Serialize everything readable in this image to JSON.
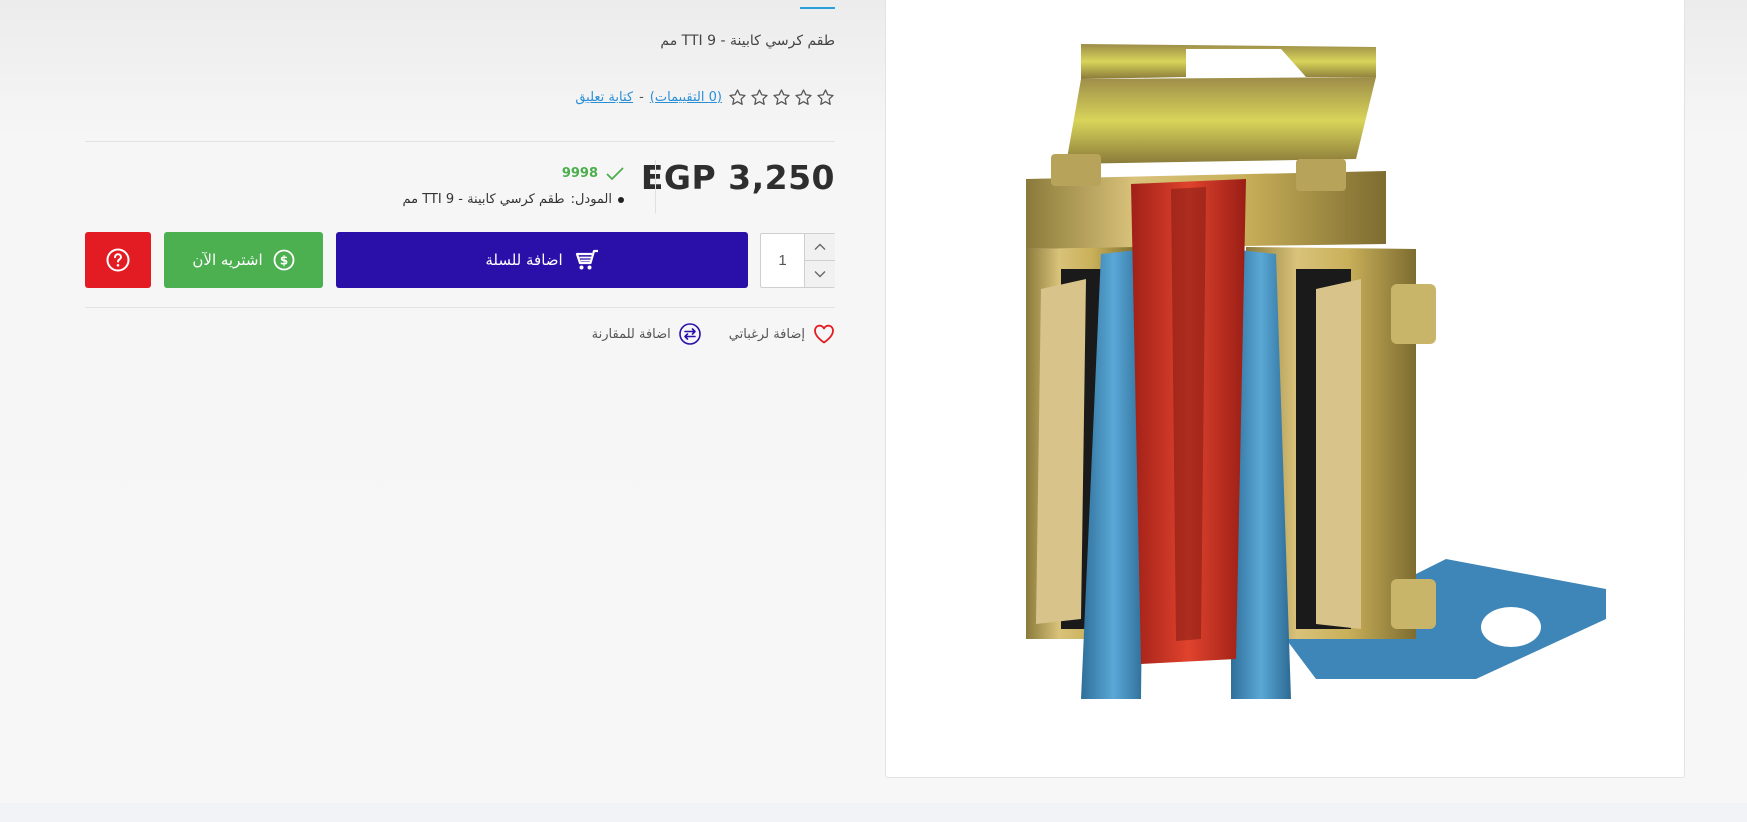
{
  "product": {
    "name": "طقم كرسي كابينة - 9 TTI مم",
    "price": "EGP 3,250",
    "stock_value": "9998",
    "model_label": "المودل:",
    "model_value": "طقم كرسي كابينة - 9 TTI مم"
  },
  "rating": {
    "stars_filled": 0,
    "stars_total": 5,
    "reviews_link": "(0 التقييمات)",
    "separator": "-",
    "write_review_link": "كتابة تعليق"
  },
  "cart": {
    "quantity": "1",
    "add_to_cart_label": "اضافة للسلة",
    "buy_now_label": "اشتريه الآن"
  },
  "links": {
    "wishlist_label": "إضافة لرغباتي",
    "compare_label": "اضافة للمقارنة"
  },
  "colors": {
    "cart_button": "#2a0fa8",
    "buy_button": "#4caf50",
    "ask_button": "#e31b23",
    "stock_green": "#4cae4c",
    "link_blue": "#2b8fd6",
    "heart_red": "#e31b23"
  },
  "icons": {
    "cart": "cart-icon",
    "buy": "dollar-circle-icon",
    "ask": "question-circle-icon",
    "wishlist": "heart-icon",
    "compare": "compare-arrows-icon",
    "stock": "check-icon",
    "rating": "star-outline-icon"
  }
}
